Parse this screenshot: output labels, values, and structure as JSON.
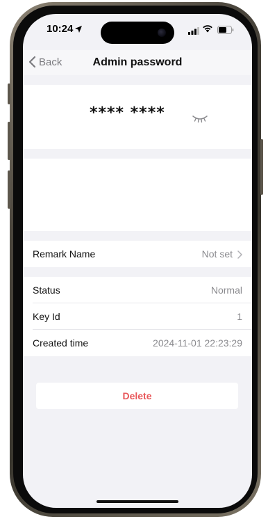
{
  "status_bar": {
    "time": "10:24",
    "location_icon": "location-arrow-icon",
    "signal_icon": "cellular-signal-icon",
    "wifi_icon": "wifi-icon",
    "battery_icon": "battery-icon"
  },
  "nav": {
    "back_label": "Back",
    "title": "Admin password"
  },
  "password": {
    "masked_value": "**** ****",
    "toggle_icon": "eye-closed-icon"
  },
  "remark": {
    "label": "Remark Name",
    "value": "Not set"
  },
  "details": [
    {
      "label": "Status",
      "value": "Normal"
    },
    {
      "label": "Key Id",
      "value": "1"
    },
    {
      "label": "Created time",
      "value": "2024-11-01 22:23:29"
    }
  ],
  "actions": {
    "delete_label": "Delete"
  },
  "colors": {
    "background": "#f2f2f6",
    "delete_text": "#e8585b",
    "secondary_text": "#8a8a8e"
  }
}
